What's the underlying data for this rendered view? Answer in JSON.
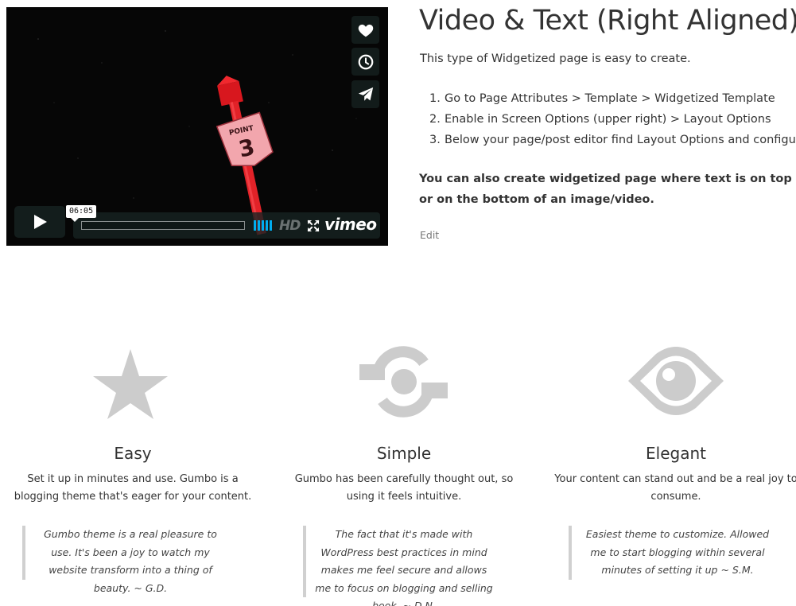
{
  "video": {
    "time": "06:05",
    "hd_label": "HD",
    "brand": "vimeo"
  },
  "content": {
    "title": "Video & Text (Right Aligned)",
    "intro": "This type of Widgetized page is easy to create.",
    "steps": [
      {
        "num": "1.",
        "text": "Go to Page Attributes > Template > Widgetized Template"
      },
      {
        "num": "2.",
        "text": "Enable in Screen Options (upper right) > Layout Options"
      },
      {
        "num": "3.",
        "text": "Below your page/post editor find Layout Options and configure"
      }
    ],
    "note": "You can also create widgetized page where text is on top or on the bottom of an image/video.",
    "edit": "Edit"
  },
  "features": [
    {
      "icon": "star-icon",
      "title": "Easy",
      "desc": "Set it up in minutes and use. Gumbo is a blogging theme that's eager for your content.",
      "quote": "Gumbo theme is a real pleasure to use. It's been a joy to watch my website transform into a thing of beauty. ~ G.D."
    },
    {
      "icon": "link-icon",
      "title": "Simple",
      "desc": "Gumbo has been carefully thought out, so using it feels intuitive.",
      "quote": "The fact that it's made with WordPress best practices in mind makes me feel secure and allows me to focus on blogging and selling book. ~ D.N."
    },
    {
      "icon": "eye-icon",
      "title": "Elegant",
      "desc": "Your content can stand out and be a real joy to consume.",
      "quote": "Easiest theme to customize. Allowed me to start blogging within several minutes of setting it up ~ S.M."
    }
  ],
  "colors": {
    "icon_gray": "#cccccc",
    "text": "#333333",
    "player_bar": "#172322",
    "volume_blue": "#00adef"
  }
}
